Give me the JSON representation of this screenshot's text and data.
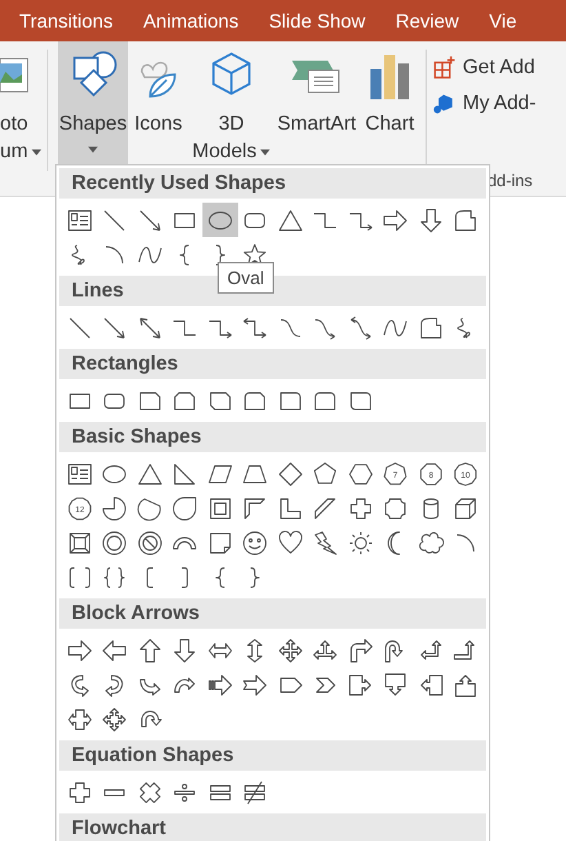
{
  "tabs": [
    "Transitions",
    "Animations",
    "Slide Show",
    "Review",
    "Vie"
  ],
  "ribbon": {
    "buttons": [
      {
        "kind": "album",
        "lines": [
          "oto",
          "um"
        ],
        "dropdown": true,
        "selected": false
      },
      {
        "kind": "shapes",
        "lines": [
          "Shapes"
        ],
        "dropdown": true,
        "selected": true
      },
      {
        "kind": "icons",
        "lines": [
          "Icons"
        ],
        "dropdown": false,
        "selected": false
      },
      {
        "kind": "models",
        "lines": [
          "3D",
          "Models"
        ],
        "dropdown": true,
        "selected": false
      },
      {
        "kind": "smartart",
        "lines": [
          "SmartArt"
        ],
        "dropdown": false,
        "selected": false
      },
      {
        "kind": "chart",
        "lines": [
          "Chart"
        ],
        "dropdown": false,
        "selected": false
      }
    ],
    "add_ins": [
      {
        "kind": "get",
        "label": "Get Add"
      },
      {
        "kind": "my",
        "label": "My Add-"
      }
    ],
    "group_label": "dd-ins"
  },
  "gallery": {
    "tooltip": "Oval",
    "sections": [
      {
        "title": "Recently Used Shapes",
        "shapes": [
          {
            "kind": "text-box",
            "selected": false
          },
          {
            "kind": "line",
            "selected": false
          },
          {
            "kind": "line-arrow",
            "selected": false
          },
          {
            "kind": "rectangle",
            "selected": false
          },
          {
            "kind": "oval",
            "selected": true
          },
          {
            "kind": "rounded-rectangle",
            "selected": false
          },
          {
            "kind": "triangle",
            "selected": false
          },
          {
            "kind": "elbow-connector",
            "selected": false
          },
          {
            "kind": "elbow-arrow",
            "selected": false
          },
          {
            "kind": "right-arrow",
            "selected": false
          },
          {
            "kind": "down-arrow",
            "selected": false
          },
          {
            "kind": "freeform",
            "selected": false
          },
          {
            "kind": "scribble",
            "selected": false
          },
          {
            "kind": "arc",
            "selected": false
          },
          {
            "kind": "curve",
            "selected": false
          },
          {
            "kind": "left-brace",
            "selected": false
          },
          {
            "kind": "right-brace",
            "selected": false
          },
          {
            "kind": "star",
            "selected": false
          }
        ]
      },
      {
        "title": "Lines",
        "shapes": [
          {
            "kind": "line",
            "selected": false
          },
          {
            "kind": "line-arrow",
            "selected": false
          },
          {
            "kind": "double-arrow",
            "selected": false
          },
          {
            "kind": "elbow-connector",
            "selected": false
          },
          {
            "kind": "elbow-arrow",
            "selected": false
          },
          {
            "kind": "elbow-double-arrow",
            "selected": false
          },
          {
            "kind": "curved-connector",
            "selected": false
          },
          {
            "kind": "curved-arrow",
            "selected": false
          },
          {
            "kind": "curved-double-arrow",
            "selected": false
          },
          {
            "kind": "curve",
            "selected": false
          },
          {
            "kind": "freeform",
            "selected": false
          },
          {
            "kind": "scribble",
            "selected": false
          }
        ]
      },
      {
        "title": "Rectangles",
        "shapes": [
          {
            "kind": "rectangle",
            "selected": false
          },
          {
            "kind": "rounded-rectangle",
            "selected": false
          },
          {
            "kind": "snip-corner-rectangle",
            "selected": false
          },
          {
            "kind": "snip-side-rectangle",
            "selected": false
          },
          {
            "kind": "snip-diagonal-rectangle",
            "selected": false
          },
          {
            "kind": "snip-round-rectangle",
            "selected": false
          },
          {
            "kind": "round-corner-rectangle",
            "selected": false
          },
          {
            "kind": "round-side-rectangle",
            "selected": false
          },
          {
            "kind": "round-diagonal-rectangle",
            "selected": false
          }
        ]
      },
      {
        "title": "Basic Shapes",
        "shapes": [
          {
            "kind": "text-box",
            "selected": false
          },
          {
            "kind": "oval",
            "selected": false
          },
          {
            "kind": "triangle",
            "selected": false
          },
          {
            "kind": "right-triangle",
            "selected": false
          },
          {
            "kind": "parallelogram",
            "selected": false
          },
          {
            "kind": "trapezoid",
            "selected": false
          },
          {
            "kind": "diamond",
            "selected": false
          },
          {
            "kind": "pentagon",
            "selected": false
          },
          {
            "kind": "hexagon",
            "selected": false
          },
          {
            "kind": "heptagon",
            "label": "7",
            "selected": false
          },
          {
            "kind": "octagon",
            "label": "8",
            "selected": false
          },
          {
            "kind": "decagon",
            "label": "10",
            "selected": false
          },
          {
            "kind": "dodecagon",
            "label": "12",
            "selected": false
          },
          {
            "kind": "pie",
            "selected": false
          },
          {
            "kind": "chord",
            "selected": false
          },
          {
            "kind": "teardrop",
            "selected": false
          },
          {
            "kind": "frame",
            "selected": false
          },
          {
            "kind": "half-frame",
            "selected": false
          },
          {
            "kind": "l-shape",
            "selected": false
          },
          {
            "kind": "diagonal-stripe",
            "selected": false
          },
          {
            "kind": "cross",
            "selected": false
          },
          {
            "kind": "plaque",
            "selected": false
          },
          {
            "kind": "can",
            "selected": false
          },
          {
            "kind": "cube",
            "selected": false
          },
          {
            "kind": "bevel",
            "selected": false
          },
          {
            "kind": "donut",
            "selected": false
          },
          {
            "kind": "no-symbol",
            "selected": false
          },
          {
            "kind": "block-arc",
            "selected": false
          },
          {
            "kind": "folded-corner",
            "selected": false
          },
          {
            "kind": "smiley",
            "selected": false
          },
          {
            "kind": "heart",
            "selected": false
          },
          {
            "kind": "lightning",
            "selected": false
          },
          {
            "kind": "sun",
            "selected": false
          },
          {
            "kind": "moon",
            "selected": false
          },
          {
            "kind": "cloud",
            "selected": false
          },
          {
            "kind": "arc",
            "selected": false
          },
          {
            "kind": "double-bracket",
            "selected": false
          },
          {
            "kind": "double-brace",
            "selected": false
          },
          {
            "kind": "left-bracket",
            "selected": false
          },
          {
            "kind": "right-bracket",
            "selected": false
          },
          {
            "kind": "left-brace",
            "selected": false
          },
          {
            "kind": "right-brace",
            "selected": false
          }
        ]
      },
      {
        "title": "Block Arrows",
        "shapes": [
          {
            "kind": "right-arrow",
            "selected": false
          },
          {
            "kind": "left-arrow",
            "selected": false
          },
          {
            "kind": "up-arrow",
            "selected": false
          },
          {
            "kind": "down-arrow",
            "selected": false
          },
          {
            "kind": "left-right-arrow",
            "selected": false
          },
          {
            "kind": "up-down-arrow",
            "selected": false
          },
          {
            "kind": "quad-arrow",
            "selected": false
          },
          {
            "kind": "left-right-up-arrow",
            "selected": false
          },
          {
            "kind": "bent-arrow",
            "selected": false
          },
          {
            "kind": "u-turn-arrow",
            "selected": false
          },
          {
            "kind": "left-up-arrow",
            "selected": false
          },
          {
            "kind": "bent-up-arrow",
            "selected": false
          },
          {
            "kind": "curved-right-arrow",
            "selected": false
          },
          {
            "kind": "curved-left-arrow",
            "selected": false
          },
          {
            "kind": "curved-up-arrow",
            "selected": false
          },
          {
            "kind": "curved-down-arrow",
            "selected": false
          },
          {
            "kind": "striped-right-arrow",
            "selected": false
          },
          {
            "kind": "notched-right-arrow",
            "selected": false
          },
          {
            "kind": "pentagon-arrow",
            "selected": false
          },
          {
            "kind": "chevron",
            "selected": false
          },
          {
            "kind": "right-arrow-callout",
            "selected": false
          },
          {
            "kind": "down-arrow-callout",
            "selected": false
          },
          {
            "kind": "left-arrow-callout",
            "selected": false
          },
          {
            "kind": "up-arrow-callout",
            "selected": false
          },
          {
            "kind": "left-right-arrow-callout",
            "selected": false
          },
          {
            "kind": "quad-arrow-callout",
            "selected": false
          },
          {
            "kind": "circular-arrow",
            "selected": false
          }
        ]
      },
      {
        "title": "Equation Shapes",
        "shapes": [
          {
            "kind": "plus",
            "selected": false
          },
          {
            "kind": "minus",
            "selected": false
          },
          {
            "kind": "multiply",
            "selected": false
          },
          {
            "kind": "divide",
            "selected": false
          },
          {
            "kind": "equal",
            "selected": false
          },
          {
            "kind": "not-equal",
            "selected": false
          }
        ]
      },
      {
        "title": "Flowchart"
      }
    ]
  }
}
